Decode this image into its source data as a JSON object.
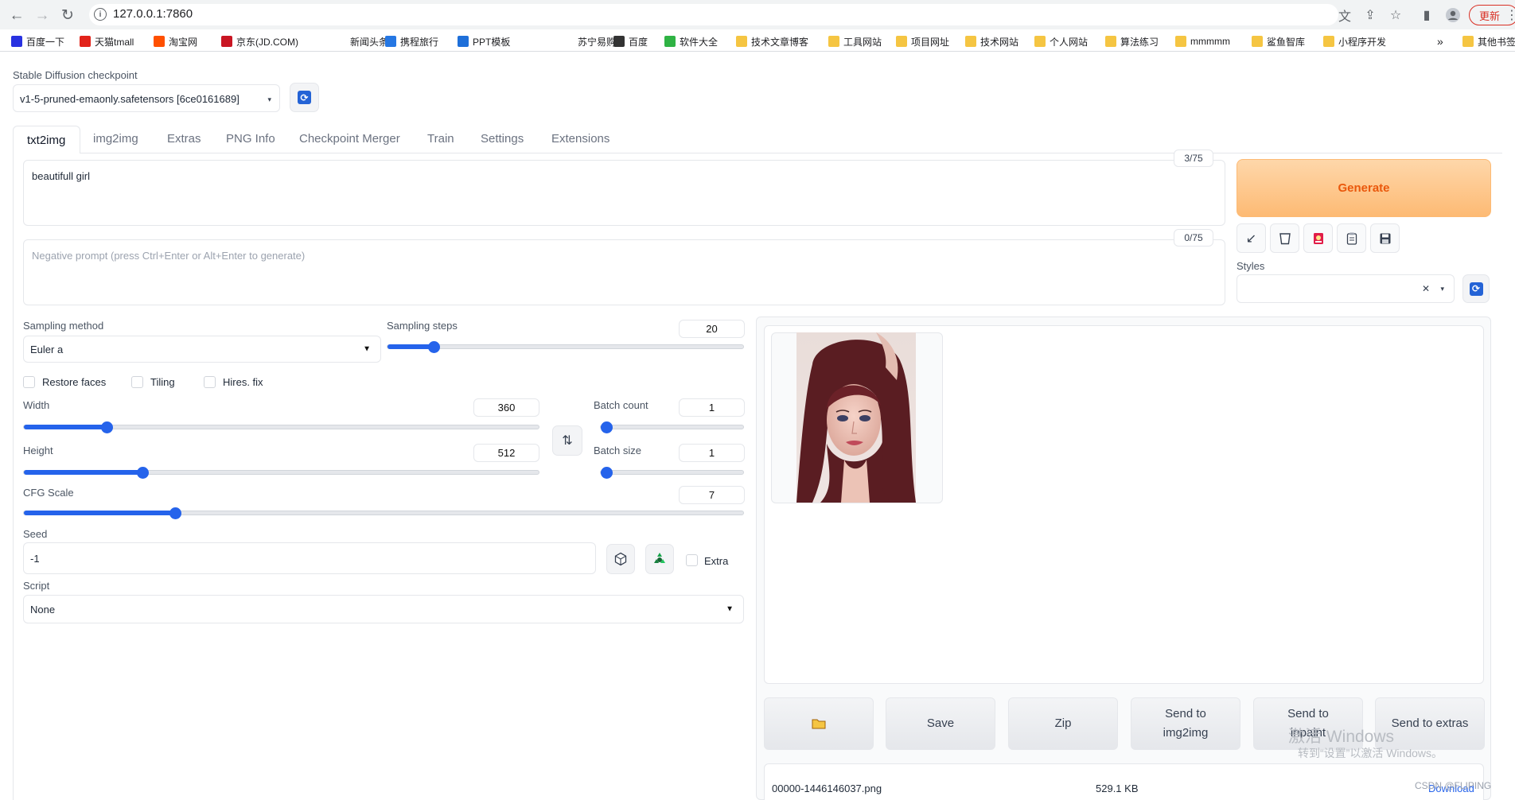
{
  "browser": {
    "url": "127.0.0.1:7860",
    "update_label": "更新",
    "bookmarks": [
      {
        "label": "百度一下",
        "color": "#2932e1"
      },
      {
        "label": "天猫tmall",
        "color": "#e2231a"
      },
      {
        "label": "淘宝网",
        "color": "#ff5000"
      },
      {
        "label": "京东(JD.COM)",
        "color": "#c91623"
      },
      {
        "label": "新闻头条",
        "color": "#ffffff"
      },
      {
        "label": "携程旅行",
        "color": "#2577e3"
      },
      {
        "label": "PPT模板",
        "color": "#1e6fd9"
      },
      {
        "label": "苏宁易购",
        "color": "#ffffff"
      },
      {
        "label": "百度",
        "color": "#333333"
      },
      {
        "label": "软件大全",
        "color": "#2fb344"
      },
      {
        "label": "技术文章博客",
        "color": "#f5c542"
      },
      {
        "label": "工具网站",
        "color": "#f5c542"
      },
      {
        "label": "项目网址",
        "color": "#f5c542"
      },
      {
        "label": "技术网站",
        "color": "#f5c542"
      },
      {
        "label": "个人网站",
        "color": "#f5c542"
      },
      {
        "label": "算法练习",
        "color": "#f5c542"
      },
      {
        "label": "mmmmm",
        "color": "#f5c542"
      },
      {
        "label": "鲨鱼智库",
        "color": "#f5c542"
      },
      {
        "label": "小程序开发",
        "color": "#f5c542"
      }
    ],
    "overflow_label": "»",
    "other_bookmarks": "其他书签"
  },
  "checkpoint": {
    "label": "Stable Diffusion checkpoint",
    "value": "v1-5-pruned-emaonly.safetensors [6ce0161689]"
  },
  "tabs": [
    "txt2img",
    "img2img",
    "Extras",
    "PNG Info",
    "Checkpoint Merger",
    "Train",
    "Settings",
    "Extensions"
  ],
  "prompt": {
    "value": "beautifull girl",
    "counter": "3/75",
    "negative_placeholder": "Negative prompt (press Ctrl+Enter or Alt+Enter to generate)",
    "negative_counter": "0/75"
  },
  "generate_label": "Generate",
  "styles": {
    "label": "Styles",
    "clear": "✕"
  },
  "sampling": {
    "method_label": "Sampling method",
    "method_value": "Euler a",
    "steps_label": "Sampling steps",
    "steps_value": "20",
    "steps_fraction": 0.13
  },
  "checkboxes": {
    "restore_faces": "Restore faces",
    "tiling": "Tiling",
    "hires_fix": "Hires. fix"
  },
  "width": {
    "label": "Width",
    "value": "360",
    "fraction": 0.16
  },
  "height": {
    "label": "Height",
    "value": "512",
    "fraction": 0.23
  },
  "batch_count": {
    "label": "Batch count",
    "value": "1",
    "fraction": 0.0
  },
  "batch_size": {
    "label": "Batch size",
    "value": "1",
    "fraction": 0.0
  },
  "cfg": {
    "label": "CFG Scale",
    "value": "7",
    "fraction": 0.21
  },
  "seed": {
    "label": "Seed",
    "value": "-1",
    "extra_label": "Extra"
  },
  "script": {
    "label": "Script",
    "value": "None"
  },
  "actions": {
    "save": "Save",
    "zip": "Zip",
    "send_img2img_1": "Send to",
    "send_img2img_2": "img2img",
    "send_inpaint_1": "Send to",
    "send_inpaint_2": "inpaint",
    "send_extras": "Send to extras"
  },
  "file": {
    "name": "00000-1446146037.png",
    "size": "529.1 KB",
    "download": "Download"
  },
  "watermark": {
    "activate_title": "激活 Windows",
    "activate_sub": "转到“设置”以激活 Windows。",
    "csdn": "CSDN @FLIPING"
  }
}
